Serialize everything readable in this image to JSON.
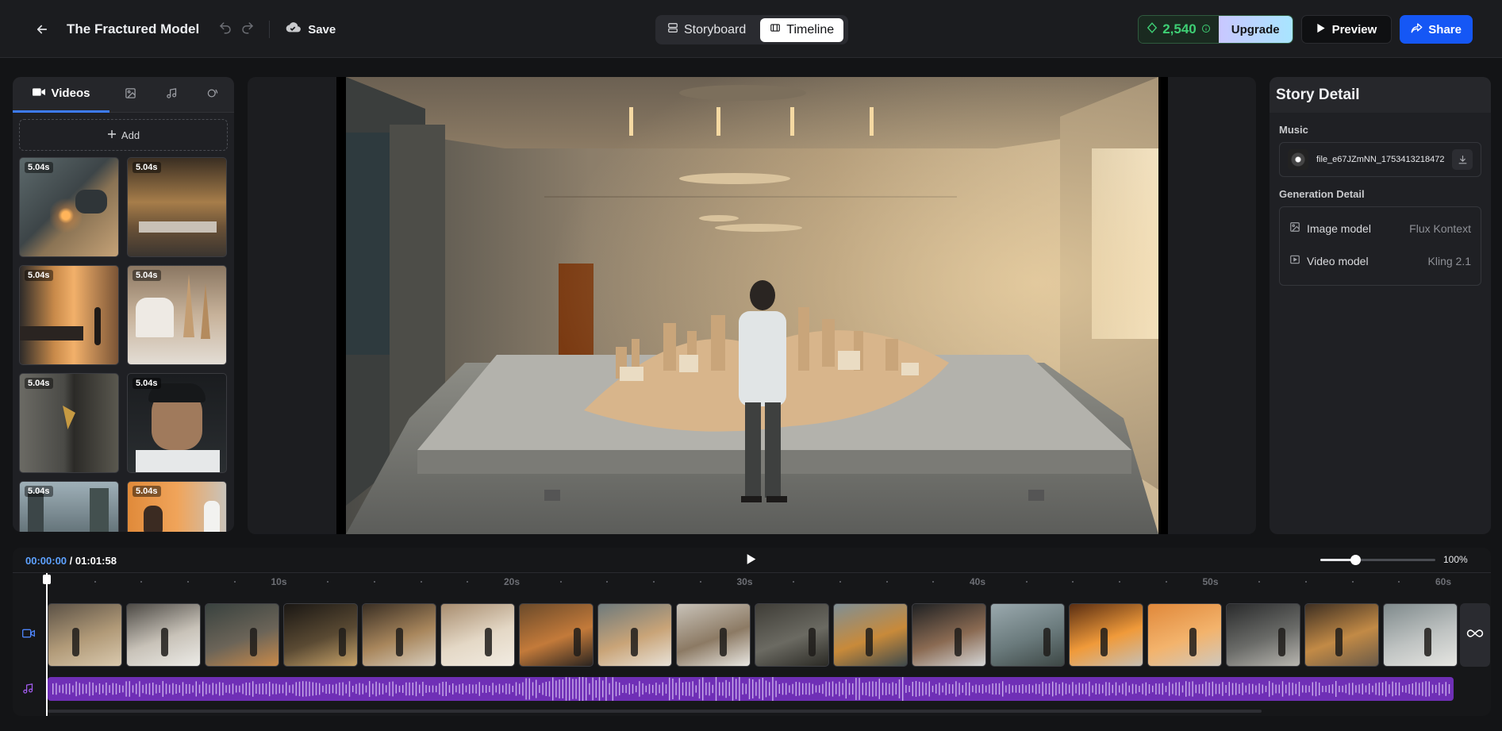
{
  "header": {
    "back_icon": "arrow-left-icon",
    "project_title": "The Fractured Model",
    "save_label": "Save",
    "view_tabs": [
      {
        "label": "Storyboard",
        "icon": "storyboard-icon",
        "active": false
      },
      {
        "label": "Timeline",
        "icon": "film-icon",
        "active": true
      }
    ],
    "credits": "2,540",
    "upgrade_label": "Upgrade",
    "preview_label": "Preview",
    "share_label": "Share",
    "accent": "#1557f5",
    "credit_color": "#3ecf74"
  },
  "media_panel": {
    "tabs": [
      {
        "label": "Videos",
        "icon": "video-camera-icon",
        "active": true
      },
      {
        "label": "",
        "icon": "image-icon"
      },
      {
        "label": "",
        "icon": "music-note-icon"
      },
      {
        "label": "",
        "icon": "voice-icon"
      }
    ],
    "add_label": "Add",
    "clips": [
      {
        "duration": "5.04s"
      },
      {
        "duration": "5.04s"
      },
      {
        "duration": "5.04s"
      },
      {
        "duration": "5.04s"
      },
      {
        "duration": "5.04s"
      },
      {
        "duration": "5.04s"
      },
      {
        "duration": "5.04s"
      },
      {
        "duration": "5.04s"
      }
    ]
  },
  "detail_panel": {
    "title": "Story Detail",
    "music_label": "Music",
    "music_file": "file_e67JZmNN_1753413218472",
    "generation_label": "Generation Detail",
    "rows": [
      {
        "key": "Image model",
        "value": "Flux Kontext",
        "icon": "image-icon"
      },
      {
        "key": "Video model",
        "value": "Kling 2.1",
        "icon": "video-icon"
      }
    ]
  },
  "timeline": {
    "current_time": "00:00:00",
    "total_time": "/ 01:01:58",
    "zoom_label": "100%",
    "zoom_level": 0.3,
    "ruler_labels": [
      "10s",
      "20s",
      "30s",
      "40s",
      "50s",
      "60s"
    ],
    "clip_count": 18
  }
}
